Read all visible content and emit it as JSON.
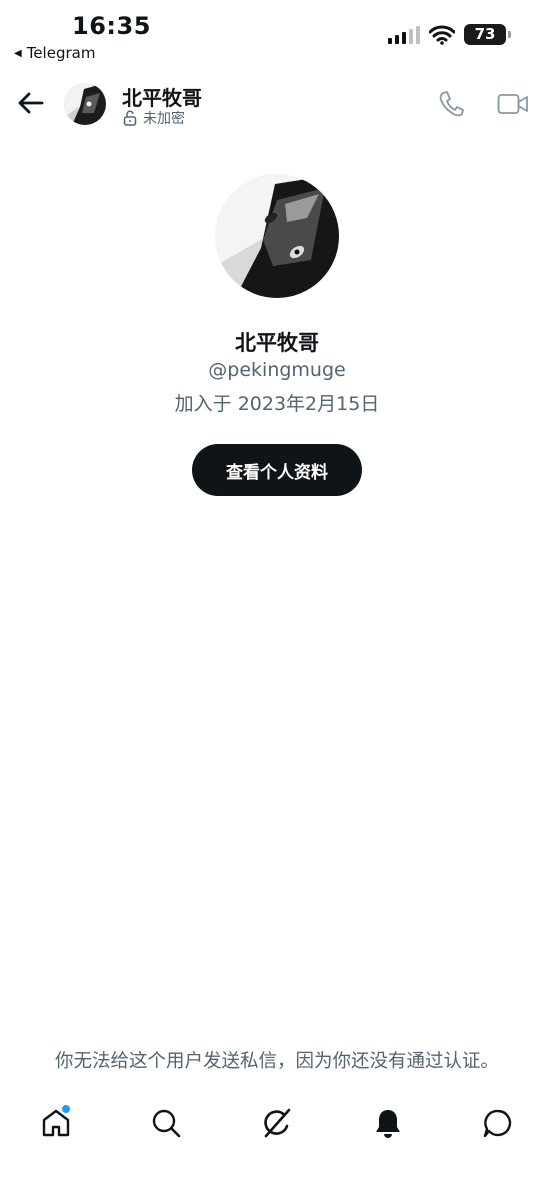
{
  "status_bar": {
    "time": "16:35",
    "back_app": "Telegram",
    "battery": "73"
  },
  "header": {
    "name": "北平牧哥",
    "encryption": "未加密"
  },
  "profile": {
    "name": "北平牧哥",
    "handle": "@pekingmuge",
    "joined": "加入于 2023年2月15日",
    "view_button": "查看个人资料"
  },
  "notice": "你无法给这个用户发送私信，因为你还没有通过认证。",
  "colors": {
    "accent_dot": "#1d9bf0",
    "button_bg": "#0f1419",
    "secondary_text": "#536471"
  },
  "tabbar": {
    "icons": [
      "home-icon",
      "search-icon",
      "grok-icon",
      "bell-icon",
      "messages-icon"
    ]
  }
}
